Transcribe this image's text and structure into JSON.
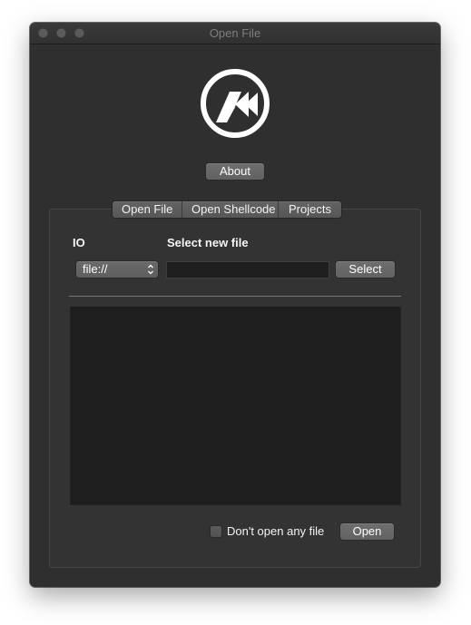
{
  "window": {
    "title": "Open File"
  },
  "about_button": {
    "label": "About"
  },
  "tabs": [
    {
      "label": "Open File",
      "selected": true
    },
    {
      "label": "Open Shellcode",
      "selected": false
    },
    {
      "label": "Projects",
      "selected": false
    }
  ],
  "open_file": {
    "io_label": "IO",
    "select_label": "Select new file",
    "io_select": {
      "value": "file://"
    },
    "file_path": {
      "value": ""
    },
    "select_button": "Select",
    "no_file_checkbox": {
      "label": "Don't open any file",
      "checked": false
    },
    "open_button": "Open"
  },
  "icons": {
    "logo": "cutter-logo-icon",
    "select_chevrons": "chevron-updown-icon"
  },
  "colors": {
    "window_bg": "#2f2f2f",
    "text": "#ffffff",
    "field_bg": "#1e1e1e"
  }
}
